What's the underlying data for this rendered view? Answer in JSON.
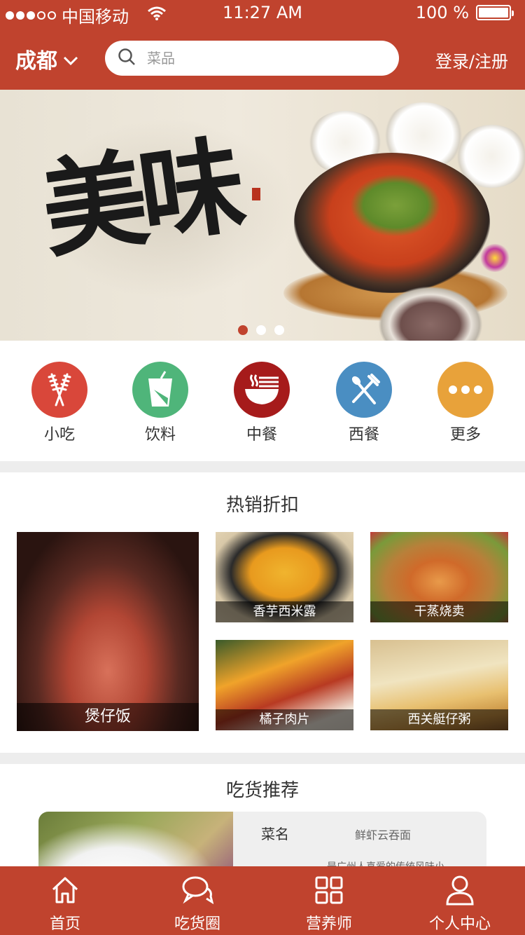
{
  "status_bar": {
    "carrier": "中国移动",
    "time": "11:27 AM",
    "battery": "100 %"
  },
  "header": {
    "city": "成都",
    "search_placeholder": "菜品",
    "login": "登录/注册"
  },
  "banner": {
    "calligraphy": "美味",
    "slide_count": 3,
    "active_slide": 1
  },
  "categories": [
    {
      "label": "小吃",
      "icon": "snack-skewer-icon",
      "color": "#d9473a"
    },
    {
      "label": "饮料",
      "icon": "drink-cup-icon",
      "color": "#4fb57a"
    },
    {
      "label": "中餐",
      "icon": "noodle-bowl-icon",
      "color": "#a61b1b"
    },
    {
      "label": "西餐",
      "icon": "fork-knife-icon",
      "color": "#4a8ec2"
    },
    {
      "label": "更多",
      "icon": "more-dots-icon",
      "color": "#e8a23a"
    }
  ],
  "hot": {
    "title": "热销折扣",
    "big": {
      "name": "煲仔饭"
    },
    "items": [
      {
        "name": "香芋西米露"
      },
      {
        "name": "干蒸烧卖"
      },
      {
        "name": "橘子肉片"
      },
      {
        "name": "西关艇仔粥"
      }
    ]
  },
  "recommend": {
    "title": "吃货推荐",
    "name_key": "菜名",
    "name_value": "鲜虾云吞面",
    "desc": "是广州人喜爱的传统风味小"
  },
  "tabs": [
    {
      "label": "首页",
      "icon": "home-icon"
    },
    {
      "label": "吃货圈",
      "icon": "chat-bubbles-icon"
    },
    {
      "label": "营养师",
      "icon": "grid-icon"
    },
    {
      "label": "个人中心",
      "icon": "user-icon"
    }
  ],
  "colors": {
    "brand": "#c0432e",
    "page_bg": "#ffffff",
    "separator": "#ededed"
  }
}
